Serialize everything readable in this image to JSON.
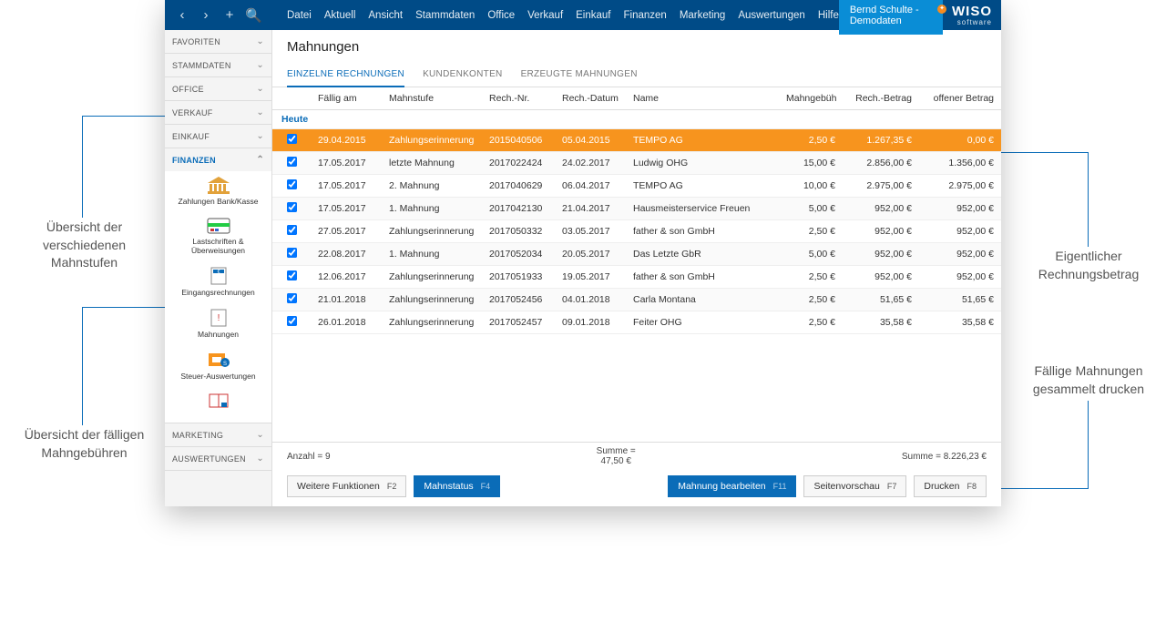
{
  "annotations": {
    "top_left": "Übersicht der verschiedenen Mahnstufen",
    "bottom_left": "Übersicht der fälligen Mahngebühren",
    "top_right": "Eigentlicher Rechnungsbetrag",
    "bottom_right": "Fällige Mahnungen gesammelt drucken"
  },
  "user": "Bernd Schulte - Demodaten",
  "brand": {
    "name": "WISO",
    "sub": "software"
  },
  "menu": [
    "Datei",
    "Aktuell",
    "Ansicht",
    "Stammdaten",
    "Office",
    "Verkauf",
    "Einkauf",
    "Finanzen",
    "Marketing",
    "Auswertungen",
    "Hilfe"
  ],
  "sidebar_groups": [
    "FAVORITEN",
    "STAMMDATEN",
    "OFFICE",
    "VERKAUF",
    "EINKAUF",
    "FINANZEN",
    "MARKETING",
    "AUSWERTUNGEN"
  ],
  "finance_items": [
    "Zahlungen Bank/Kasse",
    "Lastschriften & Überweisungen",
    "Eingangsrechnungen",
    "Mahnungen",
    "Steuer-Auswertungen"
  ],
  "page_title": "Mahnungen",
  "tabs": [
    "EINZELNE RECHNUNGEN",
    "KUNDENKONTEN",
    "ERZEUGTE MAHNUNGEN"
  ],
  "columns": [
    "",
    "Fällig am",
    "Mahnstufe",
    "Rech.-Nr.",
    "Rech.-Datum",
    "Name",
    "Mahngebüh",
    "Rech.-Betrag",
    "offener Betrag"
  ],
  "group_label": "Heute",
  "rows": [
    {
      "sel": true,
      "faellig": "29.04.2015",
      "stufe": "Zahlungserinnerung",
      "nr": "2015040506",
      "rdat": "05.04.2015",
      "name": "TEMPO AG",
      "geb": "2,50 €",
      "betr": "1.267,35 €",
      "offen": "0,00 €"
    },
    {
      "faellig": "17.05.2017",
      "stufe": "letzte Mahnung",
      "nr": "2017022424",
      "rdat": "24.02.2017",
      "name": "Ludwig OHG",
      "geb": "15,00 €",
      "betr": "2.856,00 €",
      "offen": "1.356,00 €"
    },
    {
      "faellig": "17.05.2017",
      "stufe": "2. Mahnung",
      "nr": "2017040629",
      "rdat": "06.04.2017",
      "name": "TEMPO AG",
      "geb": "10,00 €",
      "betr": "2.975,00 €",
      "offen": "2.975,00 €"
    },
    {
      "faellig": "17.05.2017",
      "stufe": "1. Mahnung",
      "nr": "2017042130",
      "rdat": "21.04.2017",
      "name": "Hausmeisterservice Freuen",
      "geb": "5,00 €",
      "betr": "952,00 €",
      "offen": "952,00 €"
    },
    {
      "faellig": "27.05.2017",
      "stufe": "Zahlungserinnerung",
      "nr": "2017050332",
      "rdat": "03.05.2017",
      "name": "father & son GmbH",
      "geb": "2,50 €",
      "betr": "952,00 €",
      "offen": "952,00 €"
    },
    {
      "faellig": "22.08.2017",
      "stufe": "1. Mahnung",
      "nr": "2017052034",
      "rdat": "20.05.2017",
      "name": "Das Letzte GbR",
      "geb": "5,00 €",
      "betr": "952,00 €",
      "offen": "952,00 €"
    },
    {
      "faellig": "12.06.2017",
      "stufe": "Zahlungserinnerung",
      "nr": "2017051933",
      "rdat": "19.05.2017",
      "name": "father & son GmbH",
      "geb": "2,50 €",
      "betr": "952,00 €",
      "offen": "952,00 €"
    },
    {
      "faellig": "21.01.2018",
      "stufe": "Zahlungserinnerung",
      "nr": "2017052456",
      "rdat": "04.01.2018",
      "name": "Carla Montana",
      "geb": "2,50 €",
      "betr": "51,65 €",
      "offen": "51,65 €"
    },
    {
      "faellig": "26.01.2018",
      "stufe": "Zahlungserinnerung",
      "nr": "2017052457",
      "rdat": "09.01.2018",
      "name": "Feiter OHG",
      "geb": "2,50 €",
      "betr": "35,58 €",
      "offen": "35,58 €"
    }
  ],
  "footer": {
    "anzahl_label": "Anzahl = 9",
    "summe_mid_label": "Summe =",
    "summe_mid_value": "47,50 €",
    "summe_right": "Summe = 8.226,23 €"
  },
  "buttons": {
    "wf": {
      "label": "Weitere Funktionen",
      "fk": "F2"
    },
    "ms": {
      "label": "Mahnstatus",
      "fk": "F4"
    },
    "mb": {
      "label": "Mahnung bearbeiten",
      "fk": "F11"
    },
    "sv": {
      "label": "Seitenvorschau",
      "fk": "F7"
    },
    "dr": {
      "label": "Drucken",
      "fk": "F8"
    }
  }
}
